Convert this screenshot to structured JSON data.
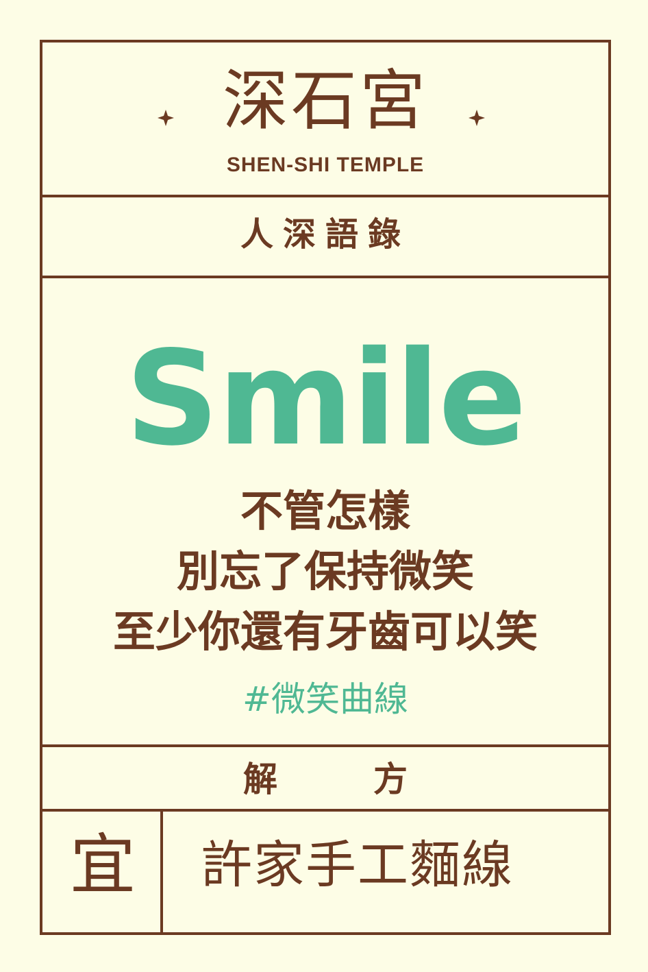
{
  "header": {
    "temple_name": "深石宮",
    "temple_name_en": "SHEN-SHI TEMPLE"
  },
  "section": {
    "title": "人深語錄"
  },
  "main": {
    "headline": "Smile",
    "quote_lines": [
      "不管怎樣",
      "別忘了保持微笑",
      "至少你還有牙齒可以笑"
    ],
    "hashtag": "#微笑曲線"
  },
  "solution": {
    "label_left": "解",
    "label_right": "方",
    "yi": "宜",
    "remedy": "許家手工麵線"
  },
  "colors": {
    "brown": "#6b3a22",
    "green": "#4fb893",
    "background": "#fdfde6"
  }
}
